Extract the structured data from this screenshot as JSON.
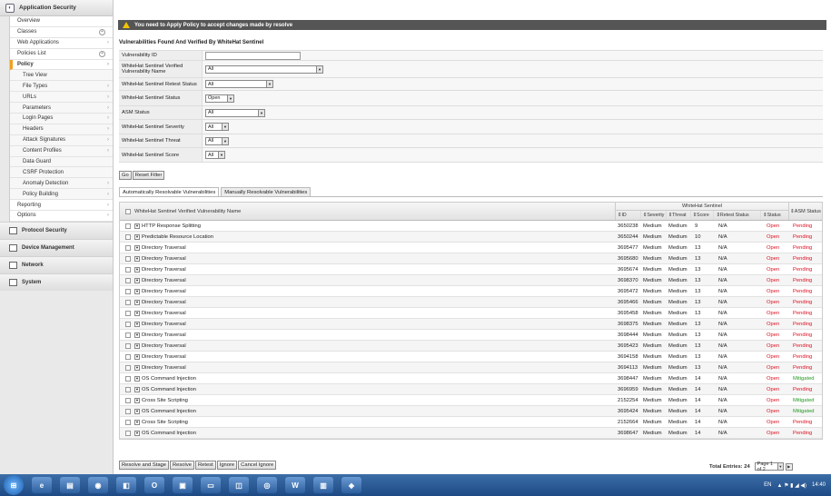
{
  "sidebar": {
    "title": "Application Security",
    "items": [
      {
        "label": "Overview",
        "type": "top"
      },
      {
        "label": "Classes",
        "type": "top",
        "plus": true
      },
      {
        "label": "Web Applications",
        "type": "top",
        "arrow": true
      },
      {
        "label": "Policies List",
        "type": "top",
        "plus": true
      },
      {
        "label": "Policy",
        "type": "top",
        "active": true,
        "arrow": true
      },
      {
        "label": "Tree View",
        "type": "sub"
      },
      {
        "label": "File Types",
        "type": "sub",
        "arrow": true
      },
      {
        "label": "URLs",
        "type": "sub",
        "arrow": true
      },
      {
        "label": "Parameters",
        "type": "sub",
        "arrow": true
      },
      {
        "label": "Login Pages",
        "type": "sub",
        "arrow": true
      },
      {
        "label": "Headers",
        "type": "sub",
        "arrow": true
      },
      {
        "label": "Attack Signatures",
        "type": "sub",
        "arrow": true
      },
      {
        "label": "Content Profiles",
        "type": "sub",
        "arrow": true
      },
      {
        "label": "Data Guard",
        "type": "sub"
      },
      {
        "label": "CSRF Protection",
        "type": "sub"
      },
      {
        "label": "Anomaly Detection",
        "type": "sub",
        "arrow": true
      },
      {
        "label": "Policy Building",
        "type": "sub",
        "arrow": true
      },
      {
        "label": "Reporting",
        "type": "top",
        "arrow": true
      },
      {
        "label": "Options",
        "type": "top",
        "arrow": true
      }
    ],
    "sections": [
      "Protocol Security",
      "Device Management",
      "Network",
      "System"
    ]
  },
  "banner": "You need to Apply Policy to accept changes made by resolve",
  "section_title": "Vulnerabilities Found And Verified By WhiteHat Sentinel",
  "filters": {
    "vuln_id": {
      "label": "Vulnerability ID",
      "value": ""
    },
    "vuln_name": {
      "label": "WhiteHat Sentinel Verified Vulnerability Name",
      "value": "All"
    },
    "retest": {
      "label": "WhiteHat Sentinel Retest Status",
      "value": "All"
    },
    "status": {
      "label": "WhiteHat Sentinel Status",
      "value": "Open"
    },
    "asm": {
      "label": "ASM Status",
      "value": "All"
    },
    "severity": {
      "label": "WhiteHat Sentinel Severity",
      "value": "All"
    },
    "threat": {
      "label": "WhiteHat Sentinel Threat",
      "value": "All"
    },
    "score": {
      "label": "WhiteHat Sentinel Score",
      "value": "All"
    }
  },
  "filter_buttons": {
    "go": "Go",
    "reset": "Reset Filter"
  },
  "tabs": [
    "Automatically Resolvable Vulnerabilities",
    "Manually Resolvable Vulnerabilities"
  ],
  "table": {
    "name_header": "WhiteHat Sentinel Verified Vulnerability Name",
    "group_header": "WhiteHat Sentinel",
    "col_headers": [
      "ID",
      "Severity",
      "Threat",
      "Score",
      "Retest Status",
      "Status"
    ],
    "asm_header": "ASM Status",
    "rows": [
      {
        "name": "HTTP Response Splitting",
        "id": "3650238",
        "severity": "Medium",
        "threat": "Medium",
        "score": "9",
        "retest": "N/A",
        "status": "Open",
        "asm": "Pending"
      },
      {
        "name": "Predictable Resource Location",
        "id": "3650244",
        "severity": "Medium",
        "threat": "Medium",
        "score": "10",
        "retest": "N/A",
        "status": "Open",
        "asm": "Pending"
      },
      {
        "name": "Directory Traversal",
        "id": "3695477",
        "severity": "Medium",
        "threat": "Medium",
        "score": "13",
        "retest": "N/A",
        "status": "Open",
        "asm": "Pending"
      },
      {
        "name": "Directory Traversal",
        "id": "3695680",
        "severity": "Medium",
        "threat": "Medium",
        "score": "13",
        "retest": "N/A",
        "status": "Open",
        "asm": "Pending"
      },
      {
        "name": "Directory Traversal",
        "id": "3695674",
        "severity": "Medium",
        "threat": "Medium",
        "score": "13",
        "retest": "N/A",
        "status": "Open",
        "asm": "Pending"
      },
      {
        "name": "Directory Traversal",
        "id": "3698370",
        "severity": "Medium",
        "threat": "Medium",
        "score": "13",
        "retest": "N/A",
        "status": "Open",
        "asm": "Pending"
      },
      {
        "name": "Directory Traversal",
        "id": "3695472",
        "severity": "Medium",
        "threat": "Medium",
        "score": "13",
        "retest": "N/A",
        "status": "Open",
        "asm": "Pending"
      },
      {
        "name": "Directory Traversal",
        "id": "3695466",
        "severity": "Medium",
        "threat": "Medium",
        "score": "13",
        "retest": "N/A",
        "status": "Open",
        "asm": "Pending"
      },
      {
        "name": "Directory Traversal",
        "id": "3695458",
        "severity": "Medium",
        "threat": "Medium",
        "score": "13",
        "retest": "N/A",
        "status": "Open",
        "asm": "Pending"
      },
      {
        "name": "Directory Traversal",
        "id": "3698375",
        "severity": "Medium",
        "threat": "Medium",
        "score": "13",
        "retest": "N/A",
        "status": "Open",
        "asm": "Pending"
      },
      {
        "name": "Directory Traversal",
        "id": "3698444",
        "severity": "Medium",
        "threat": "Medium",
        "score": "13",
        "retest": "N/A",
        "status": "Open",
        "asm": "Pending"
      },
      {
        "name": "Directory Traversal",
        "id": "3695423",
        "severity": "Medium",
        "threat": "Medium",
        "score": "13",
        "retest": "N/A",
        "status": "Open",
        "asm": "Pending"
      },
      {
        "name": "Directory Traversal",
        "id": "3694158",
        "severity": "Medium",
        "threat": "Medium",
        "score": "13",
        "retest": "N/A",
        "status": "Open",
        "asm": "Pending"
      },
      {
        "name": "Directory Traversal",
        "id": "3694113",
        "severity": "Medium",
        "threat": "Medium",
        "score": "13",
        "retest": "N/A",
        "status": "Open",
        "asm": "Pending"
      },
      {
        "name": "OS Command Injection",
        "id": "3698447",
        "severity": "Medium",
        "threat": "Medium",
        "score": "14",
        "retest": "N/A",
        "status": "Open",
        "asm": "Mitigated"
      },
      {
        "name": "OS Command Injection",
        "id": "3696959",
        "severity": "Medium",
        "threat": "Medium",
        "score": "14",
        "retest": "N/A",
        "status": "Open",
        "asm": "Pending"
      },
      {
        "name": "Cross Site Scripting",
        "id": "2152254",
        "severity": "Medium",
        "threat": "Medium",
        "score": "14",
        "retest": "N/A",
        "status": "Open",
        "asm": "Mitigated"
      },
      {
        "name": "OS Command Injection",
        "id": "3695424",
        "severity": "Medium",
        "threat": "Medium",
        "score": "14",
        "retest": "N/A",
        "status": "Open",
        "asm": "Mitigated"
      },
      {
        "name": "Cross Site Scripting",
        "id": "2152664",
        "severity": "Medium",
        "threat": "Medium",
        "score": "14",
        "retest": "N/A",
        "status": "Open",
        "asm": "Pending"
      },
      {
        "name": "OS Command Injection",
        "id": "3698647",
        "severity": "Medium",
        "threat": "Medium",
        "score": "14",
        "retest": "N/A",
        "status": "Open",
        "asm": "Pending"
      }
    ]
  },
  "bottom_buttons": [
    "Resolve and Stage",
    "Resolve",
    "Retest",
    "Ignore",
    "Cancel Ignore"
  ],
  "pager": {
    "total": "Total Entries: 24",
    "page": "Page 1 of 2"
  },
  "taskbar": {
    "tray_lang": "EN",
    "clock": "14:40"
  },
  "colors": {
    "pending": "#d12",
    "mitigated": "#229922",
    "banner_bg": "#555555",
    "active_accent": "#f0a020"
  }
}
